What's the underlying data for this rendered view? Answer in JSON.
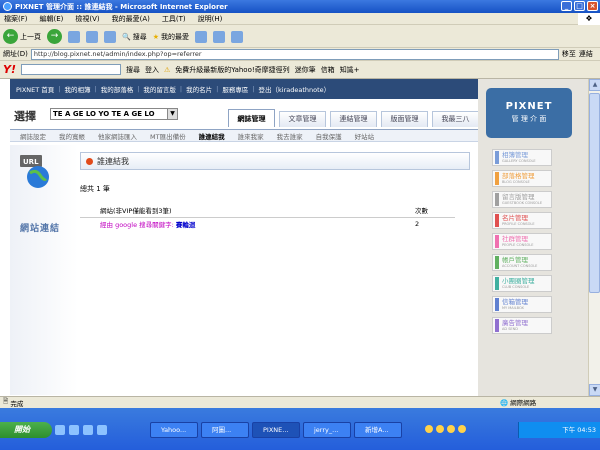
{
  "window": {
    "title": "PIXNET 管理介面 :: 誰連結我 - Microsoft Internet Explorer"
  },
  "menu": [
    "檔案(F)",
    "編輯(E)",
    "檢視(V)",
    "我的最愛(A)",
    "工具(T)",
    "說明(H)"
  ],
  "toolbar": {
    "back": "上一頁",
    "search": "搜尋",
    "favorites": "我的最愛"
  },
  "address": {
    "label": "網址(D)",
    "url": "http://blog.pixnet.net/admin/index.php?op=referrer",
    "go": "移至",
    "links": "連結"
  },
  "yahoo": {
    "logo": "Y!",
    "search_btn": "搜尋",
    "login": "登入",
    "upgrade": "免費升級最新版的Yahoo!奇摩捷徑列",
    "messenger": "迷你筆",
    "mail": "信箱",
    "knowledge": "知識+"
  },
  "nav": {
    "items": [
      "PIXNET 首頁",
      "我的相簿",
      "我的部落格",
      "我的留言版",
      "我的名片",
      "服務專區",
      "登出（kiradeathnote）"
    ]
  },
  "blog": {
    "select_label": "選擇",
    "selected": "TE A GE LO YO TE A GE LO"
  },
  "tabs": [
    "網誌管理",
    "文章管理",
    "連結管理",
    "版面管理",
    "我最三八"
  ],
  "subnav": {
    "items": [
      "網誌設定",
      "我的寬帳",
      "他家網誌匯入",
      "MT匯出備份",
      "誰連結我",
      "誰來我家",
      "我去誰家",
      "自我保護",
      "好站站"
    ],
    "current": "誰連結我"
  },
  "sidebar": {
    "label": "網站連結",
    "icon_text": "URL"
  },
  "panel": {
    "header": "誰連結我",
    "total": "總共 1 筆",
    "columns": [
      "網站(非VIP僅能看到3筆)",
      "次數"
    ],
    "rows": [
      {
        "prefix": "經由 google 搜尋關鍵字:",
        "keyword": "賽輪迴",
        "count": "2"
      }
    ]
  },
  "pixnet": {
    "name": "PIXNET",
    "sub": "管 理 介 面"
  },
  "consoles": [
    {
      "title": "相簿管理",
      "sub": "GALLERY CONSOLE",
      "color": "#7a9cd8"
    },
    {
      "title": "部落格管理",
      "sub": "BLOG CONSOLE",
      "color": "#f0a040"
    },
    {
      "title": "留言版管理",
      "sub": "GUESTBOOK CONSOLE",
      "color": "#a0a0a0"
    },
    {
      "title": "名片管理",
      "sub": "PROFILE CONSOLE",
      "color": "#e05050"
    },
    {
      "title": "社群管理",
      "sub": "PEOPLE CONSOLE",
      "color": "#f070b0"
    },
    {
      "title": "帳戶管理",
      "sub": "ACCOUNT CONSOLE",
      "color": "#60b060"
    },
    {
      "title": "小團圈管理",
      "sub": "CLUB CONSOLE",
      "color": "#40b0a0"
    },
    {
      "title": "信箱管理",
      "sub": "MY MAILBOX",
      "color": "#6080d0"
    },
    {
      "title": "廣告管理",
      "sub": "AD SEND",
      "color": "#9070d0"
    }
  ],
  "status": {
    "text": "完成",
    "zone": "網際網路"
  },
  "taskbar": {
    "start": "開始",
    "tasks": [
      "Yahoo...",
      "阿圖...",
      "PIXNE...",
      "jerry_...",
      "新增A..."
    ],
    "active_task": "PIXNE...",
    "clock": "下午 04:53"
  },
  "colors": {
    "nav_bg": "#2c4b79",
    "title_blue": "#1652c4",
    "panel_accent": "#e14b1b"
  }
}
